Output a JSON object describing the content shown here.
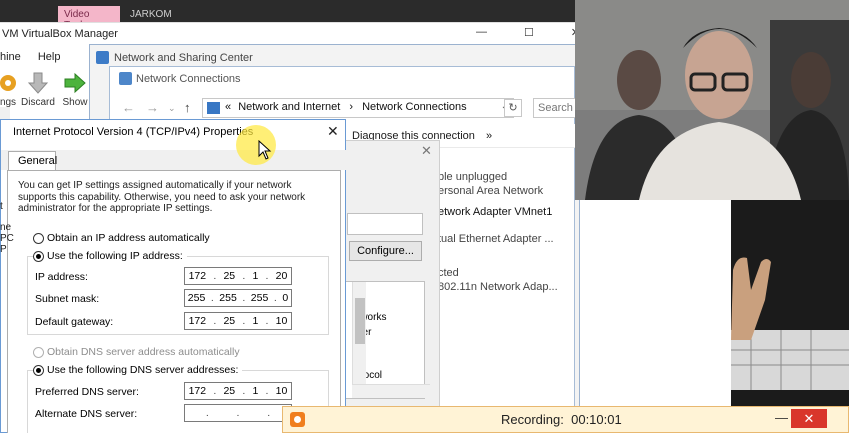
{
  "top_tabs": {
    "video_tools": "Video Tools",
    "jarkom": "JARKOM"
  },
  "vbox": {
    "title": "VM VirtualBox Manager",
    "controls": {
      "minimize": "—",
      "maximize": "☐",
      "close": "✕"
    },
    "menu": [
      "hine",
      "Help"
    ],
    "toolbar": {
      "settings": "ngs",
      "discard": "Discard",
      "show": "Show"
    },
    "side_letters": [
      "t",
      "ne",
      "PC",
      "P"
    ]
  },
  "nsc": {
    "title": "Network and Sharing Center"
  },
  "nc": {
    "title": "Network Connections",
    "breadcrumb_prefix": "«",
    "breadcrumb_1": "Network and Internet",
    "breadcrumb_sep": "›",
    "breadcrumb_2": "Network Connections",
    "search_placeholder": "Search N",
    "diagnose": "Diagnose this connection",
    "more": "»",
    "adapters": [
      {
        "line": "ble unplugged"
      },
      {
        "line": "ersonal Area Network"
      },
      {
        "line": "etwork Adapter VMnet1"
      },
      {
        "line": "tual Ethernet Adapter ..."
      },
      {
        "line": "cted"
      },
      {
        "line": "802.11n Network Adap..."
      }
    ]
  },
  "props": {
    "configure": "Configure...",
    "list": [
      "etworks",
      "river",
      "",
      "rotocol"
    ]
  },
  "ipv4": {
    "title": "Internet Protocol Version 4 (TCP/IPv4) Properties",
    "close": "✕",
    "tab": "General",
    "info": "You can get IP settings assigned automatically if your network supports this capability. Otherwise, you need to ask your network administrator for the appropriate IP settings.",
    "obtain_ip_auto": "Obtain an IP address automatically",
    "use_following_ip": "Use the following IP address:",
    "ip_label": "IP address:",
    "ip": [
      "172",
      "25",
      "1",
      "20"
    ],
    "mask_label": "Subnet mask:",
    "mask": [
      "255",
      "255",
      "255",
      "0"
    ],
    "gw_label": "Default gateway:",
    "gw": [
      "172",
      "25",
      "1",
      "10"
    ],
    "obtain_dns_auto": "Obtain DNS server address automatically",
    "use_following_dns": "Use the following DNS server addresses:",
    "pref_dns_label": "Preferred DNS server:",
    "pref_dns": [
      "172",
      "25",
      "1",
      "10"
    ],
    "alt_dns_label": "Alternate DNS server:",
    "alt_dns": [
      "",
      "",
      "",
      ""
    ],
    "selected": {
      "ip_mode": "manual",
      "dns_mode": "manual"
    }
  },
  "recording": {
    "label": "Recording:",
    "time": "00:10:01",
    "minimize": "—",
    "close": "✕"
  },
  "colors": {
    "accent": "#3d7bc7",
    "record_orange": "#f07e1e",
    "close_red": "#d9362b",
    "cursor_highlight": "#ffe83c"
  }
}
